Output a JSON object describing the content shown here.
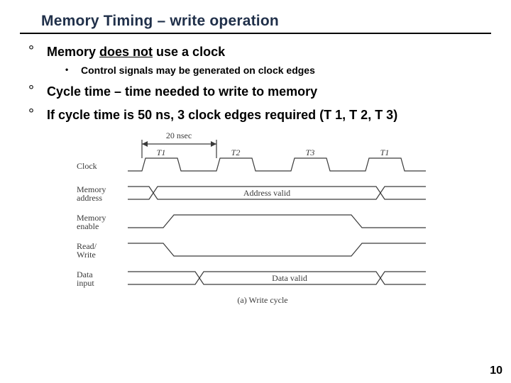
{
  "slide": {
    "title": "Memory Timing – write operation",
    "bullets": [
      {
        "pre": "Memory ",
        "em": "does not",
        "post": " use a clock",
        "sub": [
          "Control signals may be generated on clock edges"
        ]
      },
      {
        "text": "Cycle time – time needed to write to memory"
      },
      {
        "text": "If cycle time is 50 ns, 3 clock edges required (T 1, T 2, T 3)"
      }
    ],
    "page_number": "10"
  },
  "diagram": {
    "time_label": "20 nsec",
    "signals": {
      "clock": "Clock",
      "addr": "Memory\naddress",
      "enable": "Memory\nenable",
      "rw": "Read/\nWrite",
      "data": "Data\ninput"
    },
    "ticks": [
      "T1",
      "T2",
      "T3",
      "T1"
    ],
    "addr_label": "Address valid",
    "data_label": "Data valid",
    "caption": "(a) Write cycle"
  }
}
